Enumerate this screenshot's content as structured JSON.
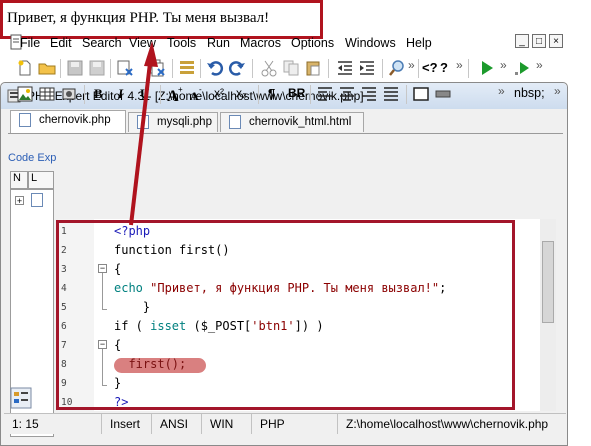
{
  "browser_output": {
    "text": "Привет, я функция PHP. Ты меня вызвал!"
  },
  "window": {
    "title": "PHP Expert Editor 4.3 - [Z:\\home\\localhost\\www\\chernovik.php]"
  },
  "menu": [
    "File",
    "Edit",
    "Search",
    "View",
    "Tools",
    "Run",
    "Macros",
    "Options",
    "Windows",
    "Help"
  ],
  "toolbar_text": {
    "bold": "B",
    "italic": "I",
    "underline": "U",
    "sup": "x²",
    "sub": "x₂",
    "para": "¶",
    "br": "BR",
    "nbsp": "nbsp;",
    "php_tag": "<?"
  },
  "tabs": [
    "chernovik.php",
    "mysqli.php",
    "chernovik_html.html"
  ],
  "left_panel": {
    "tab_label": "Code Exp",
    "col1": "N",
    "col2": "L"
  },
  "line_numbers": [
    "1",
    "2",
    "3",
    "4",
    "5",
    "6",
    "7",
    "8",
    "9",
    "10"
  ],
  "code": {
    "l1": "<?php",
    "l2": "function first()",
    "l3": "{",
    "l4_kw": "echo",
    "l4_str": "\"Привет, я функция PHP. Ты меня вызвал!\"",
    "l4_end": ";",
    "l5": "    }",
    "l6_a": "if ( ",
    "l6_kw": "isset",
    "l6_b": " ($_POST[",
    "l6_str": "'btn1'",
    "l6_c": "]) )",
    "l7": "{",
    "l8": "  first();",
    "l9": "}",
    "l10": "?>"
  },
  "status": {
    "pos": "1: 15",
    "mode": "Insert",
    "enc": "ANSI",
    "eol": "WIN",
    "lang": "PHP",
    "path": "Z:\\home\\localhost\\www\\chernovik.php"
  },
  "colors": {
    "highlight_frame": "#a3152a",
    "arrow": "#b0131e"
  }
}
